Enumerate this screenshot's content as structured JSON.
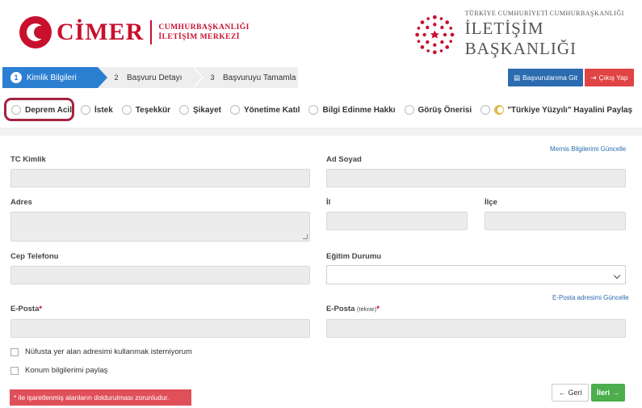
{
  "header": {
    "left_logo_text": "CİMER",
    "left_logo_sub_1": "CUMHURBAŞKANLIĞI",
    "left_logo_sub_2": "İLETİŞİM MERKEZİ",
    "right_logo_small": "TÜRKİYE CUMHURİYETİ CUMHURBAŞKANLIĞI",
    "right_logo_big": "İLETİŞİM BAŞKANLIĞI"
  },
  "steps": [
    {
      "num": "1",
      "label": "Kimlik Bilgileri"
    },
    {
      "num": "2",
      "label": "Başvuru Detayı"
    },
    {
      "num": "3",
      "label": "Başvuruyu Tamamla"
    }
  ],
  "top_buttons": {
    "basvurular": "Başvurularıma Git",
    "cikis": "Çıkış Yap"
  },
  "categories": [
    "Deprem Acil",
    "İstek",
    "Teşekkür",
    "Şikayet",
    "Yönetime Katıl",
    "Bilgi Edinme Hakkı",
    "Görüş Önerisi",
    "\"Türkiye Yüzyılı\" Hayalini Paylaş"
  ],
  "form": {
    "mernis_link": "Mernis Bilgilerimi Güncelle",
    "tc_label": "TC Kimlik",
    "adsoyad_label": "Ad Soyad",
    "adres_label": "Adres",
    "il_label": "İl",
    "ilce_label": "İlçe",
    "cep_label": "Cep Telefonu",
    "egitim_label": "Eğitim Durumu",
    "eposta_link": "E-Posta adresimi Güncelle",
    "eposta_label": "E-Posta",
    "eposta_tekrar_label": "E-Posta",
    "eposta_tekrar_small": "(tekrar)",
    "required_mark": "*",
    "chk_nufus": "Nüfusta yer alan adresimi kullanmak istemiyorum",
    "chk_konum": "Konum bilgilerimi paylaş",
    "warning": "* ile işaretlenmiş alanların doldurulması zorunludur.",
    "btn_geri": "Geri",
    "btn_ileri": "İleri"
  },
  "colors": {
    "brand_red": "#c8102e",
    "step_active": "#2b7fd1",
    "highlight_border": "#a2243f",
    "btn_primary": "#2b6cb0",
    "btn_danger": "#e14444",
    "btn_success": "#4cae4c"
  }
}
